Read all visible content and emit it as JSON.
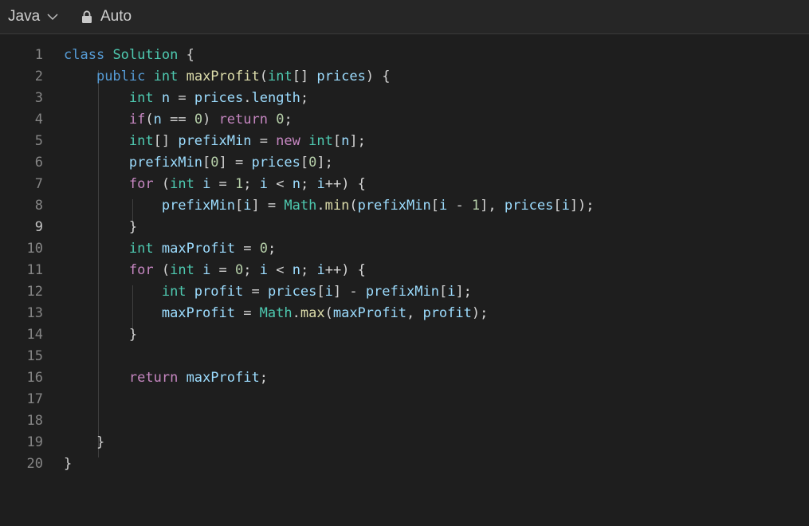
{
  "toolbar": {
    "language": "Java",
    "mode": "Auto"
  },
  "editor": {
    "active_line": 9,
    "lines": [
      {
        "no": "1",
        "tokens": [
          [
            "k",
            "class"
          ],
          [
            "p",
            " "
          ],
          [
            "t",
            "Solution"
          ],
          [
            "p",
            " {"
          ]
        ]
      },
      {
        "no": "2",
        "tokens": [
          [
            "p",
            "    "
          ],
          [
            "k",
            "public"
          ],
          [
            "p",
            " "
          ],
          [
            "t",
            "int"
          ],
          [
            "p",
            " "
          ],
          [
            "f",
            "maxProfit"
          ],
          [
            "p",
            "("
          ],
          [
            "t",
            "int"
          ],
          [
            "p",
            "[] "
          ],
          [
            "v",
            "prices"
          ],
          [
            "p",
            ") {"
          ]
        ]
      },
      {
        "no": "3",
        "tokens": [
          [
            "p",
            "        "
          ],
          [
            "t",
            "int"
          ],
          [
            "p",
            " "
          ],
          [
            "v",
            "n"
          ],
          [
            "p",
            " = "
          ],
          [
            "v",
            "prices"
          ],
          [
            "p",
            "."
          ],
          [
            "v",
            "length"
          ],
          [
            "p",
            ";"
          ]
        ]
      },
      {
        "no": "4",
        "tokens": [
          [
            "p",
            "        "
          ],
          [
            "c",
            "if"
          ],
          [
            "p",
            "("
          ],
          [
            "v",
            "n"
          ],
          [
            "p",
            " == "
          ],
          [
            "n",
            "0"
          ],
          [
            "p",
            ") "
          ],
          [
            "c",
            "return"
          ],
          [
            "p",
            " "
          ],
          [
            "n",
            "0"
          ],
          [
            "p",
            ";"
          ]
        ]
      },
      {
        "no": "5",
        "tokens": [
          [
            "p",
            "        "
          ],
          [
            "t",
            "int"
          ],
          [
            "p",
            "[] "
          ],
          [
            "v",
            "prefixMin"
          ],
          [
            "p",
            " = "
          ],
          [
            "c",
            "new"
          ],
          [
            "p",
            " "
          ],
          [
            "t",
            "int"
          ],
          [
            "p",
            "["
          ],
          [
            "v",
            "n"
          ],
          [
            "p",
            "];"
          ]
        ]
      },
      {
        "no": "6",
        "tokens": [
          [
            "p",
            "        "
          ],
          [
            "v",
            "prefixMin"
          ],
          [
            "p",
            "["
          ],
          [
            "n",
            "0"
          ],
          [
            "p",
            "] = "
          ],
          [
            "v",
            "prices"
          ],
          [
            "p",
            "["
          ],
          [
            "n",
            "0"
          ],
          [
            "p",
            "];"
          ]
        ]
      },
      {
        "no": "7",
        "tokens": [
          [
            "p",
            "        "
          ],
          [
            "c",
            "for"
          ],
          [
            "p",
            " ("
          ],
          [
            "t",
            "int"
          ],
          [
            "p",
            " "
          ],
          [
            "v",
            "i"
          ],
          [
            "p",
            " = "
          ],
          [
            "n",
            "1"
          ],
          [
            "p",
            "; "
          ],
          [
            "v",
            "i"
          ],
          [
            "p",
            " < "
          ],
          [
            "v",
            "n"
          ],
          [
            "p",
            "; "
          ],
          [
            "v",
            "i"
          ],
          [
            "p",
            "++) {"
          ]
        ]
      },
      {
        "no": "8",
        "tokens": [
          [
            "p",
            "            "
          ],
          [
            "v",
            "prefixMin"
          ],
          [
            "p",
            "["
          ],
          [
            "v",
            "i"
          ],
          [
            "p",
            "] = "
          ],
          [
            "t",
            "Math"
          ],
          [
            "p",
            "."
          ],
          [
            "f",
            "min"
          ],
          [
            "p",
            "("
          ],
          [
            "v",
            "prefixMin"
          ],
          [
            "p",
            "["
          ],
          [
            "v",
            "i"
          ],
          [
            "p",
            " - "
          ],
          [
            "n",
            "1"
          ],
          [
            "p",
            "], "
          ],
          [
            "v",
            "prices"
          ],
          [
            "p",
            "["
          ],
          [
            "v",
            "i"
          ],
          [
            "p",
            "]);"
          ]
        ]
      },
      {
        "no": "9",
        "tokens": [
          [
            "p",
            "        }"
          ]
        ]
      },
      {
        "no": "10",
        "tokens": [
          [
            "p",
            "        "
          ],
          [
            "t",
            "int"
          ],
          [
            "p",
            " "
          ],
          [
            "v",
            "maxProfit"
          ],
          [
            "p",
            " = "
          ],
          [
            "n",
            "0"
          ],
          [
            "p",
            ";"
          ]
        ]
      },
      {
        "no": "11",
        "tokens": [
          [
            "p",
            "        "
          ],
          [
            "c",
            "for"
          ],
          [
            "p",
            " ("
          ],
          [
            "t",
            "int"
          ],
          [
            "p",
            " "
          ],
          [
            "v",
            "i"
          ],
          [
            "p",
            " = "
          ],
          [
            "n",
            "0"
          ],
          [
            "p",
            "; "
          ],
          [
            "v",
            "i"
          ],
          [
            "p",
            " < "
          ],
          [
            "v",
            "n"
          ],
          [
            "p",
            "; "
          ],
          [
            "v",
            "i"
          ],
          [
            "p",
            "++) {"
          ]
        ]
      },
      {
        "no": "12",
        "tokens": [
          [
            "p",
            "            "
          ],
          [
            "t",
            "int"
          ],
          [
            "p",
            " "
          ],
          [
            "v",
            "profit"
          ],
          [
            "p",
            " = "
          ],
          [
            "v",
            "prices"
          ],
          [
            "p",
            "["
          ],
          [
            "v",
            "i"
          ],
          [
            "p",
            "] - "
          ],
          [
            "v",
            "prefixMin"
          ],
          [
            "p",
            "["
          ],
          [
            "v",
            "i"
          ],
          [
            "p",
            "];"
          ]
        ]
      },
      {
        "no": "13",
        "tokens": [
          [
            "p",
            "            "
          ],
          [
            "v",
            "maxProfit"
          ],
          [
            "p",
            " = "
          ],
          [
            "t",
            "Math"
          ],
          [
            "p",
            "."
          ],
          [
            "f",
            "max"
          ],
          [
            "p",
            "("
          ],
          [
            "v",
            "maxProfit"
          ],
          [
            "p",
            ", "
          ],
          [
            "v",
            "profit"
          ],
          [
            "p",
            ");"
          ]
        ]
      },
      {
        "no": "14",
        "tokens": [
          [
            "p",
            "        }"
          ]
        ]
      },
      {
        "no": "15",
        "tokens": []
      },
      {
        "no": "16",
        "tokens": [
          [
            "p",
            "        "
          ],
          [
            "c",
            "return"
          ],
          [
            "p",
            " "
          ],
          [
            "v",
            "maxProfit"
          ],
          [
            "p",
            ";"
          ]
        ]
      },
      {
        "no": "17",
        "tokens": []
      },
      {
        "no": "18",
        "tokens": []
      },
      {
        "no": "19",
        "tokens": [
          [
            "p",
            "    }"
          ]
        ]
      },
      {
        "no": "20",
        "tokens": [
          [
            "p",
            "}"
          ]
        ]
      }
    ]
  },
  "colors": {
    "background": "#1e1e1e",
    "keyword": "#569cd6",
    "control": "#c586c0",
    "type": "#4ec9b0",
    "function": "#dcdcaa",
    "variable": "#9cdcfe",
    "number": "#b5cea8"
  }
}
